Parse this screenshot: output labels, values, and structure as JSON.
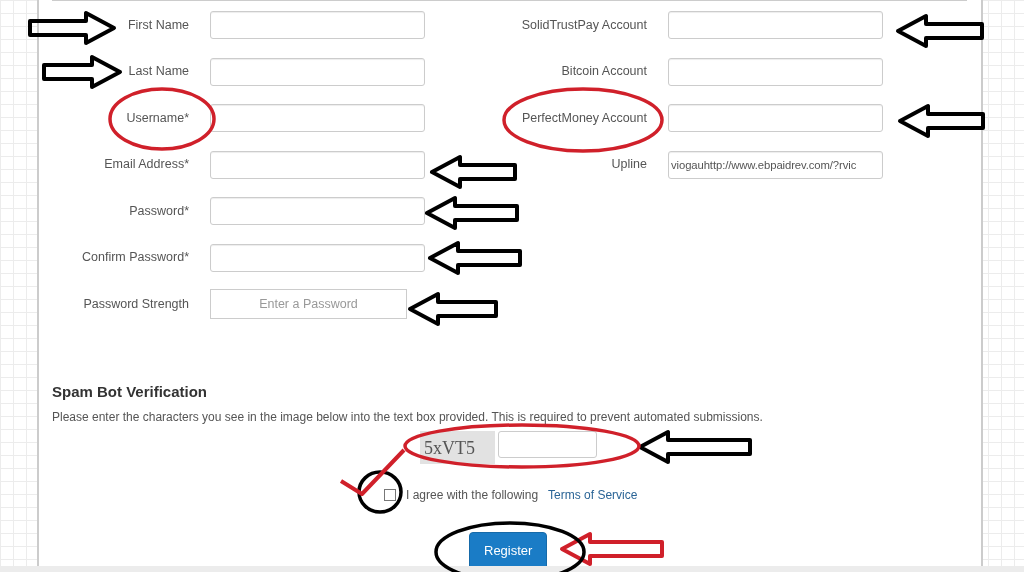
{
  "left_fields": [
    {
      "label": "First Name",
      "kind": "input"
    },
    {
      "label": "Last Name",
      "kind": "input"
    },
    {
      "label": "Username*",
      "kind": "input"
    },
    {
      "label": "Email Address*",
      "kind": "input"
    },
    {
      "label": "Password*",
      "kind": "input"
    },
    {
      "label": "Confirm Password*",
      "kind": "input"
    },
    {
      "label": "Password Strength",
      "kind": "meter",
      "text": "Enter a Password"
    }
  ],
  "right_fields": [
    {
      "label": "SolidTrustPay Account",
      "kind": "input"
    },
    {
      "label": "Bitcoin Account",
      "kind": "input"
    },
    {
      "label": "PerfectMoney Account",
      "kind": "input"
    },
    {
      "label": "Upline",
      "kind": "input",
      "value": "viogauhttp://www.ebpaidrev.com/?rvic"
    }
  ],
  "spam": {
    "heading": "Spam Bot Verification",
    "instructions": "Please enter the characters you see in the image below into the text box provided. This is required to prevent automated submissions.",
    "captcha": "5xVT5"
  },
  "agree": {
    "text": "I agree with the following",
    "link": "Terms of Service",
    "checked": false
  },
  "submit": "Register"
}
